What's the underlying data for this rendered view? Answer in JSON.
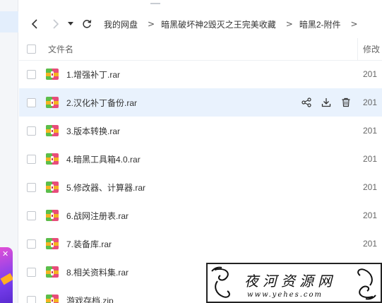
{
  "nav": {
    "back_icon": "chevron-left-icon",
    "forward_icon": "chevron-right-icon",
    "history_icon": "caret-down-icon",
    "refresh_icon": "refresh-icon"
  },
  "breadcrumb": {
    "items": [
      "我的网盘",
      "暗黑破坏神2毁灭之王完美收藏",
      "暗黑2-附件"
    ],
    "separator": ">"
  },
  "list_header": {
    "name_label": "文件名",
    "modified_label": "修改"
  },
  "files": [
    {
      "name": "1.增强补丁.rar",
      "date": "201"
    },
    {
      "name": "2.汉化补丁备份.rar",
      "date": "201"
    },
    {
      "name": "3.版本转换.rar",
      "date": "201"
    },
    {
      "name": "4.暗黑工具箱4.0.rar",
      "date": "201"
    },
    {
      "name": "5.修改器、计算器.rar",
      "date": "201"
    },
    {
      "name": "6.战网注册表.rar",
      "date": "201"
    },
    {
      "name": "7.装备库.rar",
      "date": "201"
    },
    {
      "name": "8.相关资料集.rar",
      "date": "201"
    },
    {
      "name": "游戏存档.zip",
      "date": ""
    }
  ],
  "row_actions": [
    "share-icon",
    "download-icon",
    "delete-icon"
  ],
  "watermark": {
    "title": "夜河资源网",
    "url": "www.yehes.com"
  },
  "sidebar": {
    "promo_close": "✕"
  },
  "colors": {
    "hover_row": "#e9f2fd",
    "archive_icon_pink": "#e84c7a",
    "archive_icon_green": "#5bbf4a",
    "archive_icon_yellow": "#f5b321"
  }
}
